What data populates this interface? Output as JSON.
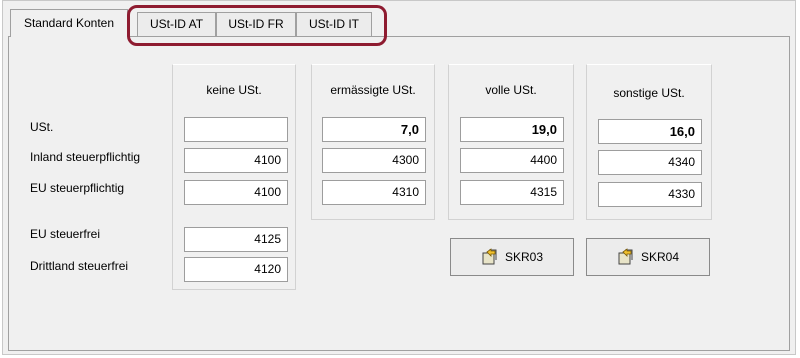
{
  "tabs": [
    "Standard Konten",
    "USt-ID AT",
    "USt-ID FR",
    "USt-ID IT"
  ],
  "columns": [
    "keine USt.",
    "ermässigte USt.",
    "volle USt.",
    "sonstige USt."
  ],
  "rows": [
    "USt.",
    "Inland steuerpflichtig",
    "EU steuerpflichtig",
    "EU steuerfrei",
    "Drittland steuerfrei"
  ],
  "values": {
    "keine": {
      "ust": "",
      "inland": "4100",
      "eu": "4100",
      "eu_steuerfrei": "4125",
      "drittland": "4120"
    },
    "ermaessigt": {
      "ust": "7,0",
      "inland": "4300",
      "eu": "4310"
    },
    "voll": {
      "ust": "19,0",
      "inland": "4400",
      "eu": "4315"
    },
    "sonstige": {
      "ust": "16,0",
      "inland": "4340",
      "eu": "4330"
    }
  },
  "buttons": {
    "skr03": "SKR03",
    "skr04": "SKR04"
  }
}
